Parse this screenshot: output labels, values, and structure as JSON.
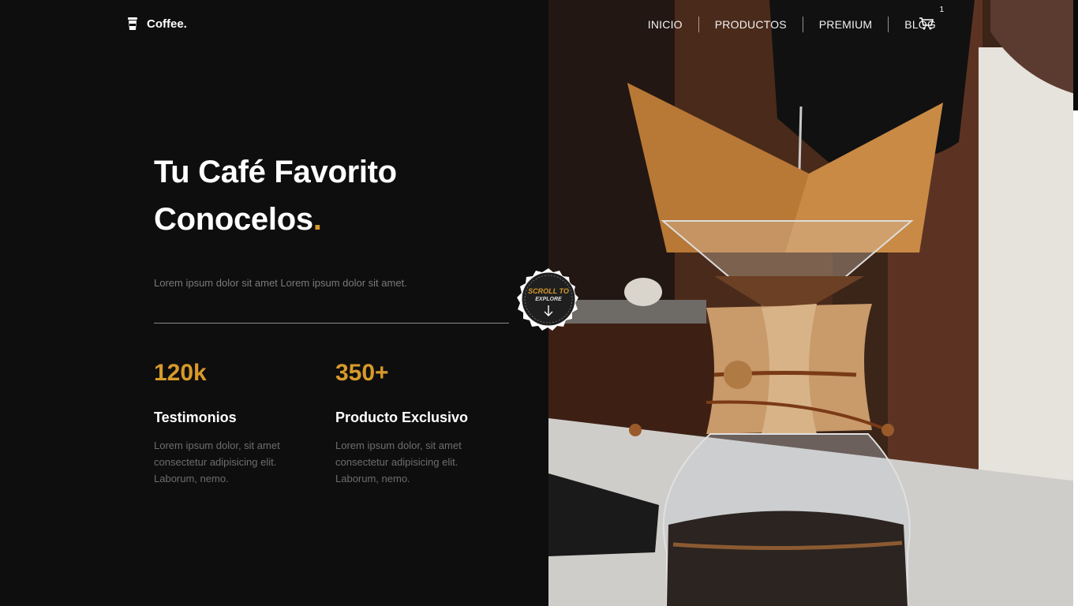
{
  "brand": {
    "name": "Coffee.",
    "icon": "coffee-cup-icon"
  },
  "nav": {
    "items": [
      "INICIO",
      "PRODUCTOS",
      "PREMIUM",
      "BLOG"
    ],
    "cart_icon": "cart-icon",
    "cart_count": "1"
  },
  "hero": {
    "title_line1": "Tu Café Favorito",
    "title_line2": "Conocelos",
    "title_dot": ".",
    "subtitle": "Lorem ipsum dolor sit amet Lorem ipsum dolor sit amet."
  },
  "stats": [
    {
      "number": "120k",
      "label": "Testimonios",
      "text": "Lorem ipsum dolor, sit amet consectetur adipisicing elit. Laborum, nemo."
    },
    {
      "number": "350+",
      "label": "Producto Exclusivo",
      "text": "Lorem ipsum dolor, sit amet consectetur adipisicing elit. Laborum, nemo."
    }
  ],
  "scroll_badge": {
    "line1": "SCROLL TO",
    "line2": "EXPLORE",
    "icon": "arrow-down-icon"
  },
  "colors": {
    "accent": "#d79a2a",
    "background": "#0f0e0e"
  }
}
